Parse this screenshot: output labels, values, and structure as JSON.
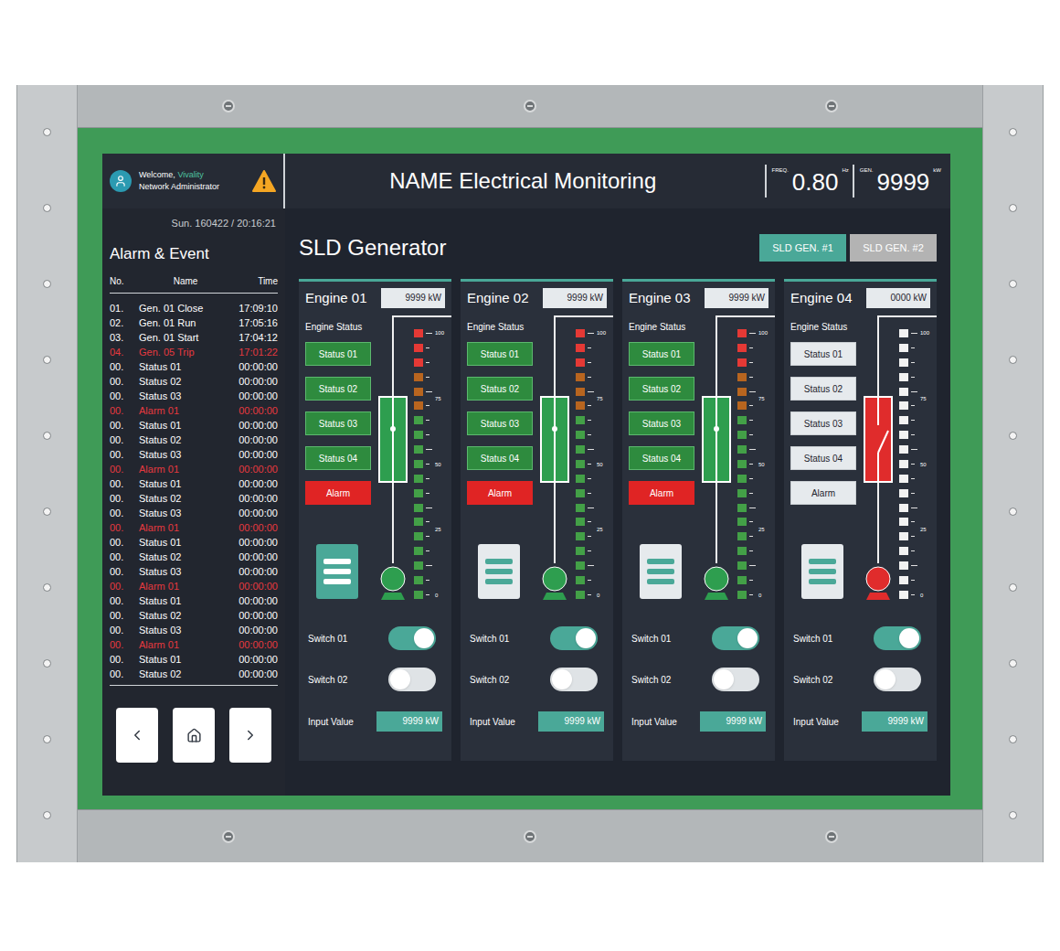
{
  "header": {
    "greeting": "Welcome,",
    "user": "Vivality",
    "role": "Network Administrator",
    "title": "NAME Electrical Monitoring",
    "readings": [
      {
        "label": "FREQ.",
        "value": "0.80",
        "unit": "Hz"
      },
      {
        "label": "GEN.",
        "value": "9999",
        "unit": "kW"
      }
    ]
  },
  "sidebar": {
    "datetime": "Sun. 160422 / 20:16:21",
    "title": "Alarm & Event",
    "columns": [
      "No.",
      "Name",
      "Time"
    ],
    "rows": [
      {
        "no": "01.",
        "name": "Gen. 01 Close",
        "time": "17:09:10",
        "alarm": false
      },
      {
        "no": "02.",
        "name": "Gen. 01 Run",
        "time": "17:05:16",
        "alarm": false
      },
      {
        "no": "03.",
        "name": "Gen. 01 Start",
        "time": "17:04:12",
        "alarm": false
      },
      {
        "no": "04.",
        "name": "Gen. 05 Trip",
        "time": "17:01:22",
        "alarm": true
      },
      {
        "no": "00.",
        "name": "Status 01",
        "time": "00:00:00",
        "alarm": false
      },
      {
        "no": "00.",
        "name": "Status 02",
        "time": "00:00:00",
        "alarm": false
      },
      {
        "no": "00.",
        "name": "Status 03",
        "time": "00:00:00",
        "alarm": false
      },
      {
        "no": "00.",
        "name": "Alarm 01",
        "time": "00:00:00",
        "alarm": true
      },
      {
        "no": "00.",
        "name": "Status 01",
        "time": "00:00:00",
        "alarm": false
      },
      {
        "no": "00.",
        "name": "Status 02",
        "time": "00:00:00",
        "alarm": false
      },
      {
        "no": "00.",
        "name": "Status 03",
        "time": "00:00:00",
        "alarm": false
      },
      {
        "no": "00.",
        "name": "Alarm 01",
        "time": "00:00:00",
        "alarm": true
      },
      {
        "no": "00.",
        "name": "Status 01",
        "time": "00:00:00",
        "alarm": false
      },
      {
        "no": "00.",
        "name": "Status 02",
        "time": "00:00:00",
        "alarm": false
      },
      {
        "no": "00.",
        "name": "Status 03",
        "time": "00:00:00",
        "alarm": false
      },
      {
        "no": "00.",
        "name": "Alarm 01",
        "time": "00:00:00",
        "alarm": true
      },
      {
        "no": "00.",
        "name": "Status 01",
        "time": "00:00:00",
        "alarm": false
      },
      {
        "no": "00.",
        "name": "Status 02",
        "time": "00:00:00",
        "alarm": false
      },
      {
        "no": "00.",
        "name": "Status 03",
        "time": "00:00:00",
        "alarm": false
      },
      {
        "no": "00.",
        "name": "Alarm 01",
        "time": "00:00:00",
        "alarm": true
      },
      {
        "no": "00.",
        "name": "Status 01",
        "time": "00:00:00",
        "alarm": false
      },
      {
        "no": "00.",
        "name": "Status 02",
        "time": "00:00:00",
        "alarm": false
      },
      {
        "no": "00.",
        "name": "Status 03",
        "time": "00:00:00",
        "alarm": false
      },
      {
        "no": "00.",
        "name": "Alarm 01",
        "time": "00:00:00",
        "alarm": true
      },
      {
        "no": "00.",
        "name": "Status 01",
        "time": "00:00:00",
        "alarm": false
      },
      {
        "no": "00.",
        "name": "Status 02",
        "time": "00:00:00",
        "alarm": false
      }
    ]
  },
  "page_title": "SLD Generator",
  "tabs": [
    {
      "label": "SLD GEN. #1",
      "selected": true
    },
    {
      "label": "SLD GEN. #2",
      "selected": false
    }
  ],
  "meter_ticks": [
    "100",
    "75",
    "50",
    "25",
    "0"
  ],
  "engines": [
    {
      "name": "Engine 01",
      "power": "9999 kW",
      "status_title": "Engine Status",
      "statuses": [
        {
          "label": "Status 01",
          "active": true
        },
        {
          "label": "Status 02",
          "active": true
        },
        {
          "label": "Status 03",
          "active": true
        },
        {
          "label": "Status 04",
          "active": true
        }
      ],
      "alarm": {
        "label": "Alarm",
        "active": true
      },
      "menu_selected": true,
      "breaker_closed": true,
      "running": true,
      "level": 1,
      "switches": [
        {
          "label": "Switch 01",
          "on": true
        },
        {
          "label": "Switch 02",
          "on": false
        }
      ],
      "input": {
        "label": "Input Value",
        "value": "9999 kW"
      }
    },
    {
      "name": "Engine 02",
      "power": "9999 kW",
      "status_title": "Engine Status",
      "statuses": [
        {
          "label": "Status 01",
          "active": true
        },
        {
          "label": "Status 02",
          "active": true
        },
        {
          "label": "Status 03",
          "active": true
        },
        {
          "label": "Status 04",
          "active": true
        }
      ],
      "alarm": {
        "label": "Alarm",
        "active": true
      },
      "menu_selected": false,
      "breaker_closed": true,
      "running": true,
      "level": 1,
      "switches": [
        {
          "label": "Switch 01",
          "on": true
        },
        {
          "label": "Switch 02",
          "on": false
        }
      ],
      "input": {
        "label": "Input Value",
        "value": "9999 kW"
      }
    },
    {
      "name": "Engine 03",
      "power": "9999 kW",
      "status_title": "Engine Status",
      "statuses": [
        {
          "label": "Status 01",
          "active": true
        },
        {
          "label": "Status 02",
          "active": true
        },
        {
          "label": "Status 03",
          "active": true
        },
        {
          "label": "Status 04",
          "active": true
        }
      ],
      "alarm": {
        "label": "Alarm",
        "active": true
      },
      "menu_selected": false,
      "breaker_closed": true,
      "running": true,
      "level": 1,
      "switches": [
        {
          "label": "Switch 01",
          "on": true
        },
        {
          "label": "Switch 02",
          "on": false
        }
      ],
      "input": {
        "label": "Input Value",
        "value": "9999 kW"
      }
    },
    {
      "name": "Engine 04",
      "power": "0000 kW",
      "status_title": "Engine Status",
      "statuses": [
        {
          "label": "Status 01",
          "active": false
        },
        {
          "label": "Status 02",
          "active": false
        },
        {
          "label": "Status 03",
          "active": false
        },
        {
          "label": "Status 04",
          "active": false
        }
      ],
      "alarm": {
        "label": "Alarm",
        "active": false
      },
      "menu_selected": false,
      "breaker_closed": false,
      "running": false,
      "level": 0,
      "switches": [
        {
          "label": "Switch 01",
          "on": true
        },
        {
          "label": "Switch 02",
          "on": false
        }
      ],
      "input": {
        "label": "Input Value",
        "value": "9999 kW"
      }
    }
  ]
}
